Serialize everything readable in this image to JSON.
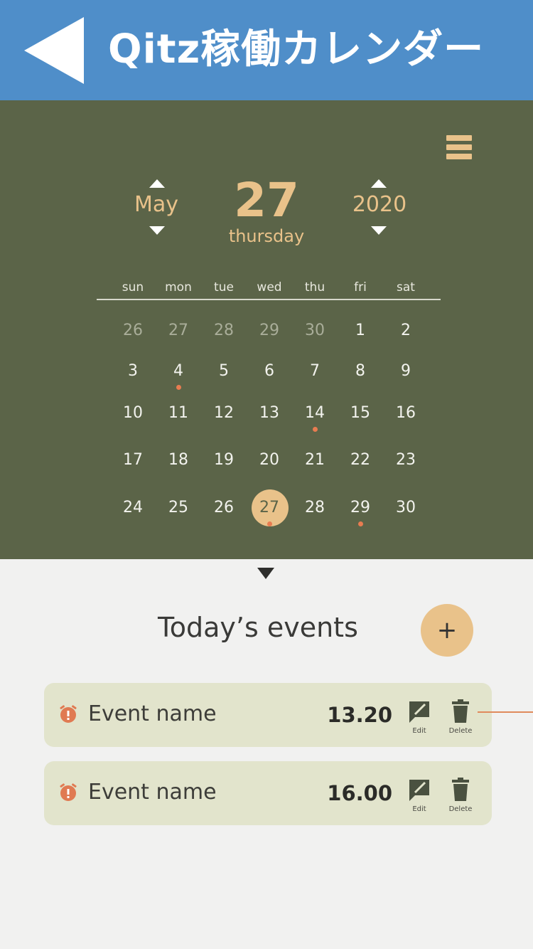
{
  "header": {
    "title": "Qitz稼働カレンダー"
  },
  "calendar": {
    "month": "May",
    "day": "27",
    "weekday": "thursday",
    "year": "2020",
    "days_of_week": [
      "sun",
      "mon",
      "tue",
      "wed",
      "thu",
      "fri",
      "sat"
    ],
    "weeks": [
      [
        {
          "d": "26",
          "muted": true
        },
        {
          "d": "27",
          "muted": true
        },
        {
          "d": "28",
          "muted": true
        },
        {
          "d": "29",
          "muted": true
        },
        {
          "d": "30",
          "muted": true
        },
        {
          "d": "1"
        },
        {
          "d": "2"
        }
      ],
      [
        {
          "d": "3"
        },
        {
          "d": "4",
          "event": true
        },
        {
          "d": "5"
        },
        {
          "d": "6"
        },
        {
          "d": "7"
        },
        {
          "d": "8"
        },
        {
          "d": "9"
        }
      ],
      [
        {
          "d": "10"
        },
        {
          "d": "11"
        },
        {
          "d": "12"
        },
        {
          "d": "13"
        },
        {
          "d": "14",
          "event": true
        },
        {
          "d": "15"
        },
        {
          "d": "16"
        }
      ],
      [
        {
          "d": "17"
        },
        {
          "d": "18"
        },
        {
          "d": "19"
        },
        {
          "d": "20"
        },
        {
          "d": "21"
        },
        {
          "d": "22"
        },
        {
          "d": "23"
        }
      ],
      [
        {
          "d": "24"
        },
        {
          "d": "25"
        },
        {
          "d": "26"
        },
        {
          "d": "27",
          "event": true,
          "selected": true
        },
        {
          "d": "28"
        },
        {
          "d": "29",
          "event": true
        },
        {
          "d": "30"
        }
      ]
    ]
  },
  "events_section": {
    "title": "Today’s events",
    "add_label": "+",
    "events": [
      {
        "name": "Event name",
        "time": "13.20",
        "edit_label": "Edit",
        "delete_label": "Delete"
      },
      {
        "name": "Event name",
        "time": "16.00",
        "edit_label": "Edit",
        "delete_label": "Delete"
      }
    ]
  },
  "colors": {
    "header_bg": "#4f8ec9",
    "calendar_bg": "#5b6448",
    "accent": "#e9c28a",
    "event_dot": "#e87c51",
    "card_bg": "#e2e4cc"
  }
}
